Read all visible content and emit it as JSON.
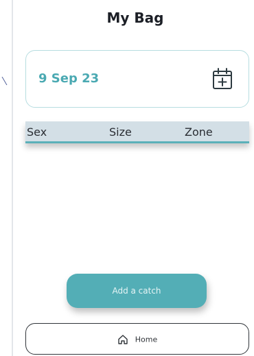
{
  "header": {
    "title": "My Bag"
  },
  "date_picker": {
    "date": "9 Sep 23",
    "icon": "calendar-add-icon"
  },
  "catch_table": {
    "columns": [
      "Sex",
      "Size",
      "Zone"
    ],
    "rows": []
  },
  "actions": {
    "add_catch_label": "Add a catch"
  },
  "nav": {
    "home_label": "Home",
    "home_icon": "home-icon"
  },
  "colors": {
    "accent": "#53aeb6",
    "date_text": "#4aa9b2",
    "table_header_bg": "#d3dfe6",
    "card_border": "#b6dde0"
  }
}
